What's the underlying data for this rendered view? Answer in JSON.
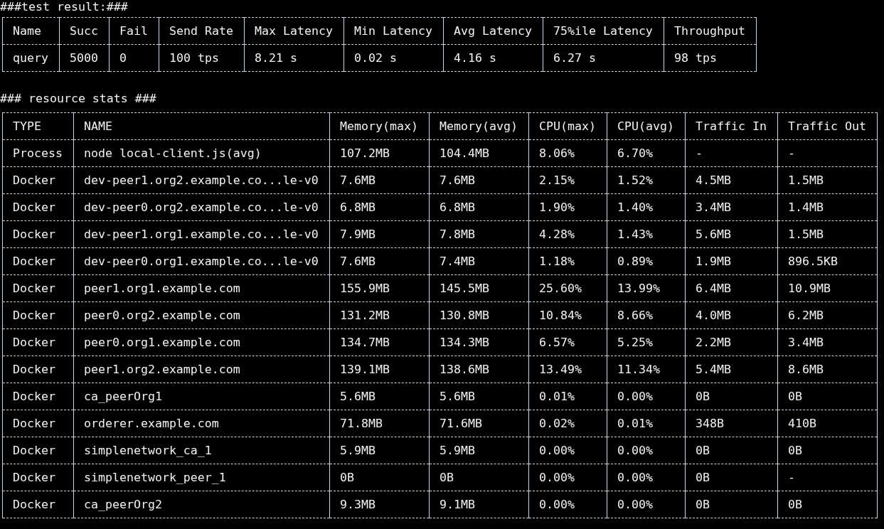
{
  "sections": [
    {
      "title": "###test result:###",
      "table": {
        "columns": [
          "Name",
          "Succ",
          "Fail",
          "Send Rate",
          "Max Latency",
          "Min Latency",
          "Avg Latency",
          "75%ile Latency",
          "Throughput"
        ],
        "rows": [
          [
            "query",
            "5000",
            "0",
            "100 tps",
            "8.21 s",
            "0.02 s",
            "4.16 s",
            "6.27 s",
            "98 tps"
          ]
        ]
      }
    },
    {
      "title": "### resource stats ###",
      "table": {
        "columns": [
          "TYPE",
          "NAME",
          "Memory(max)",
          "Memory(avg)",
          "CPU(max)",
          "CPU(avg)",
          "Traffic In",
          "Traffic Out"
        ],
        "rows": [
          [
            "Process",
            "node local-client.js(avg)",
            "107.2MB",
            "104.4MB",
            "8.06%",
            "6.70%",
            "-",
            "-"
          ],
          [
            "Docker",
            "dev-peer1.org2.example.co...le-v0",
            "7.6MB",
            "7.6MB",
            "2.15%",
            "1.52%",
            "4.5MB",
            "1.5MB"
          ],
          [
            "Docker",
            "dev-peer0.org2.example.co...le-v0",
            "6.8MB",
            "6.8MB",
            "1.90%",
            "1.40%",
            "3.4MB",
            "1.4MB"
          ],
          [
            "Docker",
            "dev-peer1.org1.example.co...le-v0",
            "7.9MB",
            "7.8MB",
            "4.28%",
            "1.43%",
            "5.6MB",
            "1.5MB"
          ],
          [
            "Docker",
            "dev-peer0.org1.example.co...le-v0",
            "7.6MB",
            "7.4MB",
            "1.18%",
            "0.89%",
            "1.9MB",
            "896.5KB"
          ],
          [
            "Docker",
            "peer1.org1.example.com",
            "155.9MB",
            "145.5MB",
            "25.60%",
            "13.99%",
            "6.4MB",
            "10.9MB"
          ],
          [
            "Docker",
            "peer0.org2.example.com",
            "131.2MB",
            "130.8MB",
            "10.84%",
            "8.66%",
            "4.0MB",
            "6.2MB"
          ],
          [
            "Docker",
            "peer0.org1.example.com",
            "134.7MB",
            "134.3MB",
            "6.57%",
            "5.25%",
            "2.2MB",
            "3.4MB"
          ],
          [
            "Docker",
            "peer1.org2.example.com",
            "139.1MB",
            "138.6MB",
            "13.49%",
            "11.34%",
            "5.4MB",
            "8.6MB"
          ],
          [
            "Docker",
            "ca_peerOrg1",
            "5.6MB",
            "5.6MB",
            "0.01%",
            "0.00%",
            "0B",
            "0B"
          ],
          [
            "Docker",
            "orderer.example.com",
            "71.8MB",
            "71.6MB",
            "0.02%",
            "0.01%",
            "348B",
            "410B"
          ],
          [
            "Docker",
            "simplenetwork_ca_1",
            "5.9MB",
            "5.9MB",
            "0.00%",
            "0.00%",
            "0B",
            "0B"
          ],
          [
            "Docker",
            "simplenetwork_peer_1",
            "0B",
            "0B",
            "0.00%",
            "0.00%",
            "0B",
            "-"
          ],
          [
            "Docker",
            "ca_peerOrg2",
            "9.3MB",
            "9.1MB",
            "0.00%",
            "0.00%",
            "0B",
            "0B"
          ]
        ]
      }
    }
  ]
}
